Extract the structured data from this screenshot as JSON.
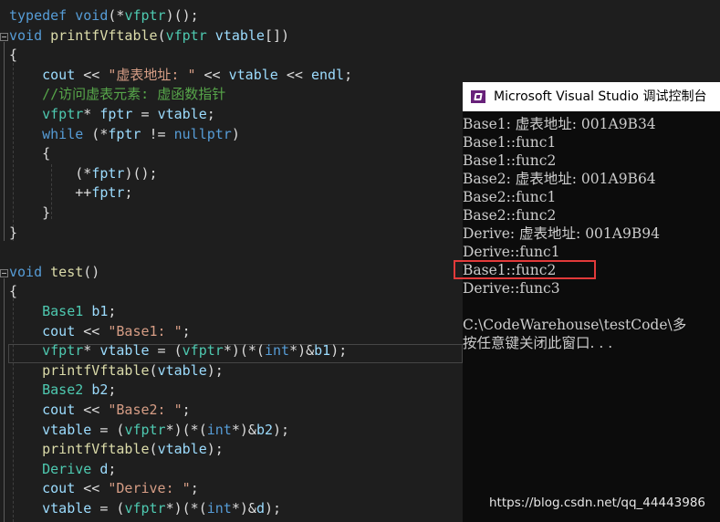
{
  "editor": {
    "lines": [
      {
        "segs": [
          {
            "c": "kw",
            "t": "typedef"
          },
          {
            "c": "pl",
            "t": " "
          },
          {
            "c": "kw",
            "t": "void"
          },
          {
            "c": "pl",
            "t": "(*"
          },
          {
            "c": "ty",
            "t": "vfptr"
          },
          {
            "c": "pl",
            "t": ")();"
          }
        ]
      },
      {
        "segs": [
          {
            "c": "kw",
            "t": "void"
          },
          {
            "c": "pl",
            "t": " "
          },
          {
            "c": "fn",
            "t": "printfVftable"
          },
          {
            "c": "pl",
            "t": "("
          },
          {
            "c": "ty",
            "t": "vfptr"
          },
          {
            "c": "pl",
            "t": " "
          },
          {
            "c": "vr",
            "t": "vtable"
          },
          {
            "c": "pl",
            "t": "[])"
          }
        ]
      },
      {
        "segs": [
          {
            "c": "pl",
            "t": "{"
          }
        ]
      },
      {
        "segs": [
          {
            "c": "pl",
            "t": "    "
          },
          {
            "c": "vr",
            "t": "cout"
          },
          {
            "c": "pl",
            "t": " << "
          },
          {
            "c": "st",
            "t": "\"虚表地址: \""
          },
          {
            "c": "pl",
            "t": " << "
          },
          {
            "c": "vr",
            "t": "vtable"
          },
          {
            "c": "pl",
            "t": " << "
          },
          {
            "c": "vr",
            "t": "endl"
          },
          {
            "c": "pl",
            "t": ";"
          }
        ]
      },
      {
        "segs": [
          {
            "c": "pl",
            "t": "    "
          },
          {
            "c": "cm",
            "t": "//访问虚表元素: 虚函数指针"
          }
        ]
      },
      {
        "segs": [
          {
            "c": "pl",
            "t": "    "
          },
          {
            "c": "ty",
            "t": "vfptr"
          },
          {
            "c": "pl",
            "t": "* "
          },
          {
            "c": "vr",
            "t": "fptr"
          },
          {
            "c": "pl",
            "t": " = "
          },
          {
            "c": "vr",
            "t": "vtable"
          },
          {
            "c": "pl",
            "t": ";"
          }
        ]
      },
      {
        "segs": [
          {
            "c": "pl",
            "t": "    "
          },
          {
            "c": "kw",
            "t": "while"
          },
          {
            "c": "pl",
            "t": " (*"
          },
          {
            "c": "vr",
            "t": "fptr"
          },
          {
            "c": "pl",
            "t": " != "
          },
          {
            "c": "kw",
            "t": "nullptr"
          },
          {
            "c": "pl",
            "t": ")"
          }
        ]
      },
      {
        "segs": [
          {
            "c": "pl",
            "t": "    {"
          }
        ]
      },
      {
        "segs": [
          {
            "c": "pl",
            "t": "        (*"
          },
          {
            "c": "vr",
            "t": "fptr"
          },
          {
            "c": "pl",
            "t": ")();"
          }
        ]
      },
      {
        "segs": [
          {
            "c": "pl",
            "t": "        ++"
          },
          {
            "c": "vr",
            "t": "fptr"
          },
          {
            "c": "pl",
            "t": ";"
          }
        ]
      },
      {
        "segs": [
          {
            "c": "pl",
            "t": "    }"
          }
        ]
      },
      {
        "segs": [
          {
            "c": "pl",
            "t": "}"
          }
        ]
      },
      {
        "segs": []
      },
      {
        "segs": [
          {
            "c": "kw",
            "t": "void"
          },
          {
            "c": "pl",
            "t": " "
          },
          {
            "c": "fn",
            "t": "test"
          },
          {
            "c": "pl",
            "t": "()"
          }
        ]
      },
      {
        "segs": [
          {
            "c": "pl",
            "t": "{"
          }
        ]
      },
      {
        "segs": [
          {
            "c": "pl",
            "t": "    "
          },
          {
            "c": "ty",
            "t": "Base1"
          },
          {
            "c": "pl",
            "t": " "
          },
          {
            "c": "vr",
            "t": "b1"
          },
          {
            "c": "pl",
            "t": ";"
          }
        ]
      },
      {
        "segs": [
          {
            "c": "pl",
            "t": "    "
          },
          {
            "c": "vr",
            "t": "cout"
          },
          {
            "c": "pl",
            "t": " << "
          },
          {
            "c": "st",
            "t": "\"Base1: \""
          },
          {
            "c": "pl",
            "t": ";"
          }
        ]
      },
      {
        "segs": [
          {
            "c": "pl",
            "t": "    "
          },
          {
            "c": "ty",
            "t": "vfptr"
          },
          {
            "c": "pl",
            "t": "* "
          },
          {
            "c": "vr",
            "t": "vtable"
          },
          {
            "c": "pl",
            "t": " = ("
          },
          {
            "c": "ty",
            "t": "vfptr"
          },
          {
            "c": "pl",
            "t": "*)(*("
          },
          {
            "c": "kw",
            "t": "int"
          },
          {
            "c": "pl",
            "t": "*)&"
          },
          {
            "c": "vr",
            "t": "b1"
          },
          {
            "c": "pl",
            "t": ");"
          }
        ]
      },
      {
        "segs": [
          {
            "c": "pl",
            "t": "    "
          },
          {
            "c": "fn",
            "t": "printfVftable"
          },
          {
            "c": "pl",
            "t": "("
          },
          {
            "c": "vr",
            "t": "vtable"
          },
          {
            "c": "pl",
            "t": ");"
          }
        ]
      },
      {
        "segs": [
          {
            "c": "pl",
            "t": "    "
          },
          {
            "c": "ty",
            "t": "Base2"
          },
          {
            "c": "pl",
            "t": " "
          },
          {
            "c": "vr",
            "t": "b2"
          },
          {
            "c": "pl",
            "t": ";"
          }
        ]
      },
      {
        "segs": [
          {
            "c": "pl",
            "t": "    "
          },
          {
            "c": "vr",
            "t": "cout"
          },
          {
            "c": "pl",
            "t": " << "
          },
          {
            "c": "st",
            "t": "\"Base2: \""
          },
          {
            "c": "pl",
            "t": ";"
          }
        ]
      },
      {
        "segs": [
          {
            "c": "pl",
            "t": "    "
          },
          {
            "c": "vr",
            "t": "vtable"
          },
          {
            "c": "pl",
            "t": " = ("
          },
          {
            "c": "ty",
            "t": "vfptr"
          },
          {
            "c": "pl",
            "t": "*)(*("
          },
          {
            "c": "kw",
            "t": "int"
          },
          {
            "c": "pl",
            "t": "*)&"
          },
          {
            "c": "vr",
            "t": "b2"
          },
          {
            "c": "pl",
            "t": ");"
          }
        ]
      },
      {
        "segs": [
          {
            "c": "pl",
            "t": "    "
          },
          {
            "c": "fn",
            "t": "printfVftable"
          },
          {
            "c": "pl",
            "t": "("
          },
          {
            "c": "vr",
            "t": "vtable"
          },
          {
            "c": "pl",
            "t": ");"
          }
        ]
      },
      {
        "segs": [
          {
            "c": "pl",
            "t": "    "
          },
          {
            "c": "ty",
            "t": "Derive"
          },
          {
            "c": "pl",
            "t": " "
          },
          {
            "c": "vr",
            "t": "d"
          },
          {
            "c": "pl",
            "t": ";"
          }
        ]
      },
      {
        "segs": [
          {
            "c": "pl",
            "t": "    "
          },
          {
            "c": "vr",
            "t": "cout"
          },
          {
            "c": "pl",
            "t": " << "
          },
          {
            "c": "st",
            "t": "\"Derive: \""
          },
          {
            "c": "pl",
            "t": ";"
          }
        ]
      },
      {
        "segs": [
          {
            "c": "pl",
            "t": "    "
          },
          {
            "c": "vr",
            "t": "vtable"
          },
          {
            "c": "pl",
            "t": " = ("
          },
          {
            "c": "ty",
            "t": "vfptr"
          },
          {
            "c": "pl",
            "t": "*)(*("
          },
          {
            "c": "kw",
            "t": "int"
          },
          {
            "c": "pl",
            "t": "*)&"
          },
          {
            "c": "vr",
            "t": "d"
          },
          {
            "c": "pl",
            "t": ");"
          }
        ]
      }
    ]
  },
  "console": {
    "title": "Microsoft Visual Studio 调试控制台",
    "lines": [
      "Base1: 虚表地址: 001A9B34",
      "Base1::func1",
      "Base1::func2",
      "Base2: 虚表地址: 001A9B64",
      "Base2::func1",
      "Base2::func2",
      "Derive: 虚表地址: 001A9B94",
      "Derive::func1",
      "Base1::func2",
      "Derive::func3",
      "",
      "C:\\CodeWarehouse\\testCode\\多",
      "按任意键关闭此窗口. . ."
    ]
  },
  "watermark": "https://blog.csdn.net/qq_44443986",
  "colors": {
    "highlight": "#e23a3a",
    "accent": "#68217a"
  }
}
